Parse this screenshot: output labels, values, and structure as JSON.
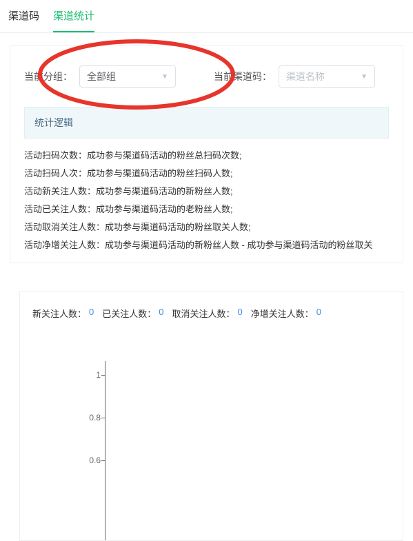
{
  "tabs": {
    "items": [
      {
        "label": "渠道码"
      },
      {
        "label": "渠道统计"
      }
    ],
    "activeIndex": 1
  },
  "filters": {
    "groupLabel": "当前分组：",
    "groupValue": "全部组",
    "channelLabel": "当前渠道码：",
    "channelPlaceholder": "渠道名称"
  },
  "logic": {
    "header": "统计逻辑",
    "lines": [
      "活动扫码次数：成功参与渠道码活动的粉丝总扫码次数;",
      "活动扫码人次：成功参与渠道码活动的粉丝扫码人数;",
      "活动新关注人数：成功参与渠道码活动的新粉丝人数;",
      "活动已关注人数：成功参与渠道码活动的老粉丝人数;",
      "活动取消关注人数：成功参与渠道码活动的粉丝取关人数;",
      "活动净增关注人数：成功参与渠道码活动的新粉丝人数 - 成功参与渠道码活动的粉丝取关"
    ]
  },
  "stats": {
    "items": [
      {
        "label": "新关注人数：",
        "value": "0"
      },
      {
        "label": "已关注人数：",
        "value": "0"
      },
      {
        "label": "取消关注人数：",
        "value": "0"
      },
      {
        "label": "净增关注人数：",
        "value": "0"
      }
    ]
  },
  "chart_data": {
    "type": "line",
    "title": "",
    "xlabel": "",
    "ylabel": "",
    "ylim": [
      0,
      1
    ],
    "y_ticks": [
      "1",
      "0.8",
      "0.6"
    ],
    "series": [],
    "categories": []
  }
}
